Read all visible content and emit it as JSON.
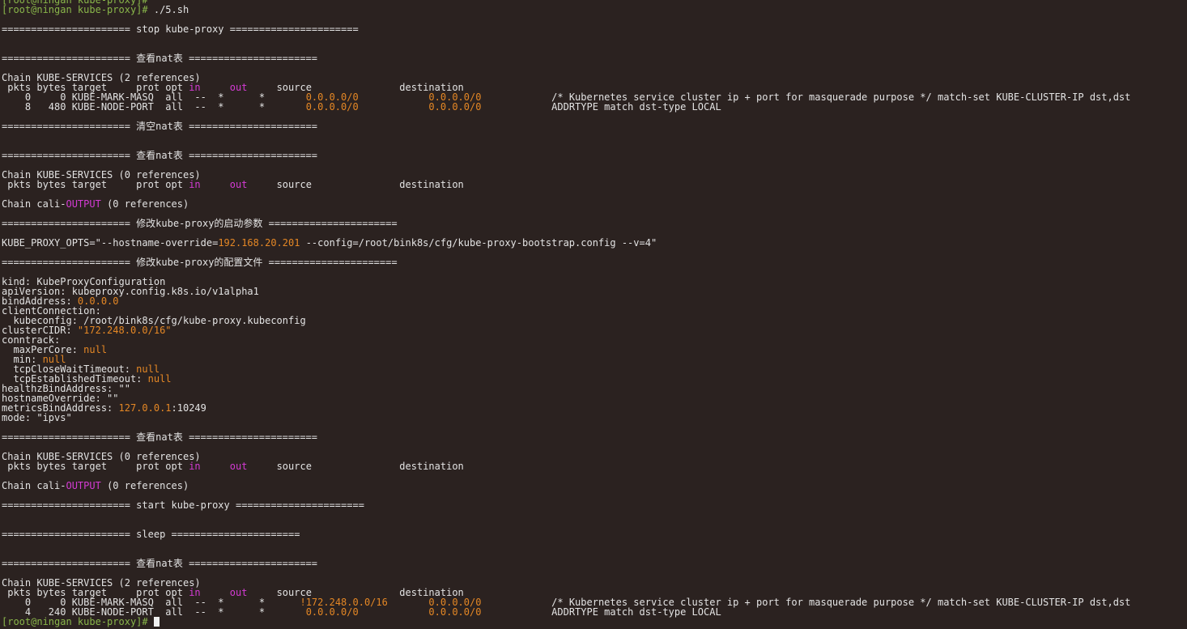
{
  "colors": {
    "background": "#2b2220",
    "text": "#e3e3e3",
    "prompt": "#89b64a",
    "keyword": "#d43bd4",
    "number": "#e48725"
  },
  "lines": [
    [
      {
        "t": "[root@ningan kube-proxy]#",
        "c": "gr"
      }
    ],
    [
      {
        "t": "[root@ningan kube-proxy]#",
        "c": "gr"
      },
      {
        "t": " ./5.sh"
      }
    ],
    [],
    [
      {
        "t": "====================== stop kube-proxy ======================"
      }
    ],
    [],
    [],
    [
      {
        "t": "====================== 查看nat表 ======================"
      }
    ],
    [],
    [
      {
        "t": "Chain KUBE-SERVICES (2 references)"
      }
    ],
    [
      {
        "t": " pkts bytes target     prot opt "
      },
      {
        "t": "in",
        "c": "mag"
      },
      {
        "t": "     "
      },
      {
        "t": "out",
        "c": "mag"
      },
      {
        "t": "     source               destination"
      }
    ],
    [
      {
        "t": "    0     0 KUBE-MARK-MASQ  all  --  *      *       "
      },
      {
        "t": "0.0.0.0/0",
        "c": "ora"
      },
      {
        "t": "            "
      },
      {
        "t": "0.0.0.0/0",
        "c": "ora"
      },
      {
        "t": "            /* Kubernetes service cluster ip + port for masquerade purpose */ match-set KUBE-CLUSTER-IP dst,dst"
      }
    ],
    [
      {
        "t": "    8   480 KUBE-NODE-PORT  all  --  *      *       "
      },
      {
        "t": "0.0.0.0/0",
        "c": "ora"
      },
      {
        "t": "            "
      },
      {
        "t": "0.0.0.0/0",
        "c": "ora"
      },
      {
        "t": "            ADDRTYPE match dst-type LOCAL"
      }
    ],
    [],
    [
      {
        "t": "====================== 清空nat表 ======================"
      }
    ],
    [],
    [],
    [
      {
        "t": "====================== 查看nat表 ======================"
      }
    ],
    [],
    [
      {
        "t": "Chain KUBE-SERVICES (0 references)"
      }
    ],
    [
      {
        "t": " pkts bytes target     prot opt "
      },
      {
        "t": "in",
        "c": "mag"
      },
      {
        "t": "     "
      },
      {
        "t": "out",
        "c": "mag"
      },
      {
        "t": "     source               destination"
      }
    ],
    [],
    [
      {
        "t": "Chain cali-"
      },
      {
        "t": "OUTPUT",
        "c": "mag"
      },
      {
        "t": " (0 references)"
      }
    ],
    [],
    [
      {
        "t": "====================== 修改kube-proxy的启动参数 ======================"
      }
    ],
    [],
    [
      {
        "t": "KUBE_PROXY_OPTS=\"--hostname-override="
      },
      {
        "t": "192.168.20.201",
        "c": "ora"
      },
      {
        "t": " --config=/root/bink8s/cfg/kube-proxy-bootstrap.config --v=4\""
      }
    ],
    [],
    [
      {
        "t": "====================== 修改kube-proxy的配置文件 ======================"
      }
    ],
    [],
    [
      {
        "t": "kind: KubeProxyConfiguration"
      }
    ],
    [
      {
        "t": "apiVersion: kubeproxy.config.k8s.io/v1alpha1"
      }
    ],
    [
      {
        "t": "bindAddress: "
      },
      {
        "t": "0.0.0.0",
        "c": "ora"
      }
    ],
    [
      {
        "t": "clientConnection:"
      }
    ],
    [
      {
        "t": "  kubeconfig: /root/bink8s/cfg/kube-proxy.kubeconfig"
      }
    ],
    [
      {
        "t": "clusterCIDR: "
      },
      {
        "t": "\"172.248.0.0/16\"",
        "c": "ora"
      }
    ],
    [
      {
        "t": "conntrack:"
      }
    ],
    [
      {
        "t": "  maxPerCore: "
      },
      {
        "t": "null",
        "c": "ora"
      }
    ],
    [
      {
        "t": "  min: "
      },
      {
        "t": "null",
        "c": "ora"
      }
    ],
    [
      {
        "t": "  tcpCloseWaitTimeout: "
      },
      {
        "t": "null",
        "c": "ora"
      }
    ],
    [
      {
        "t": "  tcpEstablishedTimeout: "
      },
      {
        "t": "null",
        "c": "ora"
      }
    ],
    [
      {
        "t": "healthzBindAddress: \"\""
      }
    ],
    [
      {
        "t": "hostnameOverride: \"\""
      }
    ],
    [
      {
        "t": "metricsBindAddress: "
      },
      {
        "t": "127.0.0.1",
        "c": "ora"
      },
      {
        "t": ":10249"
      }
    ],
    [
      {
        "t": "mode: \"ipvs\""
      }
    ],
    [],
    [
      {
        "t": "====================== 查看nat表 ======================"
      }
    ],
    [],
    [
      {
        "t": "Chain KUBE-SERVICES (0 references)"
      }
    ],
    [
      {
        "t": " pkts bytes target     prot opt "
      },
      {
        "t": "in",
        "c": "mag"
      },
      {
        "t": "     "
      },
      {
        "t": "out",
        "c": "mag"
      },
      {
        "t": "     source               destination"
      }
    ],
    [],
    [
      {
        "t": "Chain cali-"
      },
      {
        "t": "OUTPUT",
        "c": "mag"
      },
      {
        "t": " (0 references)"
      }
    ],
    [],
    [
      {
        "t": "====================== start kube-proxy ======================"
      }
    ],
    [],
    [],
    [
      {
        "t": "====================== sleep ======================"
      }
    ],
    [],
    [],
    [
      {
        "t": "====================== 查看nat表 ======================"
      }
    ],
    [],
    [
      {
        "t": "Chain KUBE-SERVICES (2 references)"
      }
    ],
    [
      {
        "t": " pkts bytes target     prot opt "
      },
      {
        "t": "in",
        "c": "mag"
      },
      {
        "t": "     "
      },
      {
        "t": "out",
        "c": "mag"
      },
      {
        "t": "     source               destination"
      }
    ],
    [
      {
        "t": "    0     0 KUBE-MARK-MASQ  all  --  *      *      "
      },
      {
        "t": "!172.248.0.0/16",
        "c": "ora"
      },
      {
        "t": "       "
      },
      {
        "t": "0.0.0.0/0",
        "c": "ora"
      },
      {
        "t": "            /* Kubernetes service cluster ip + port for masquerade purpose */ match-set KUBE-CLUSTER-IP dst,dst"
      }
    ],
    [
      {
        "t": "    4   240 KUBE-NODE-PORT  all  --  *      *       "
      },
      {
        "t": "0.0.0.0/0",
        "c": "ora"
      },
      {
        "t": "            "
      },
      {
        "t": "0.0.0.0/0",
        "c": "ora"
      },
      {
        "t": "            ADDRTYPE match dst-type LOCAL"
      }
    ],
    [
      {
        "t": "[root@ningan kube-proxy]#",
        "c": "gr"
      },
      {
        "t": " "
      },
      {
        "cursor": true
      }
    ]
  ]
}
